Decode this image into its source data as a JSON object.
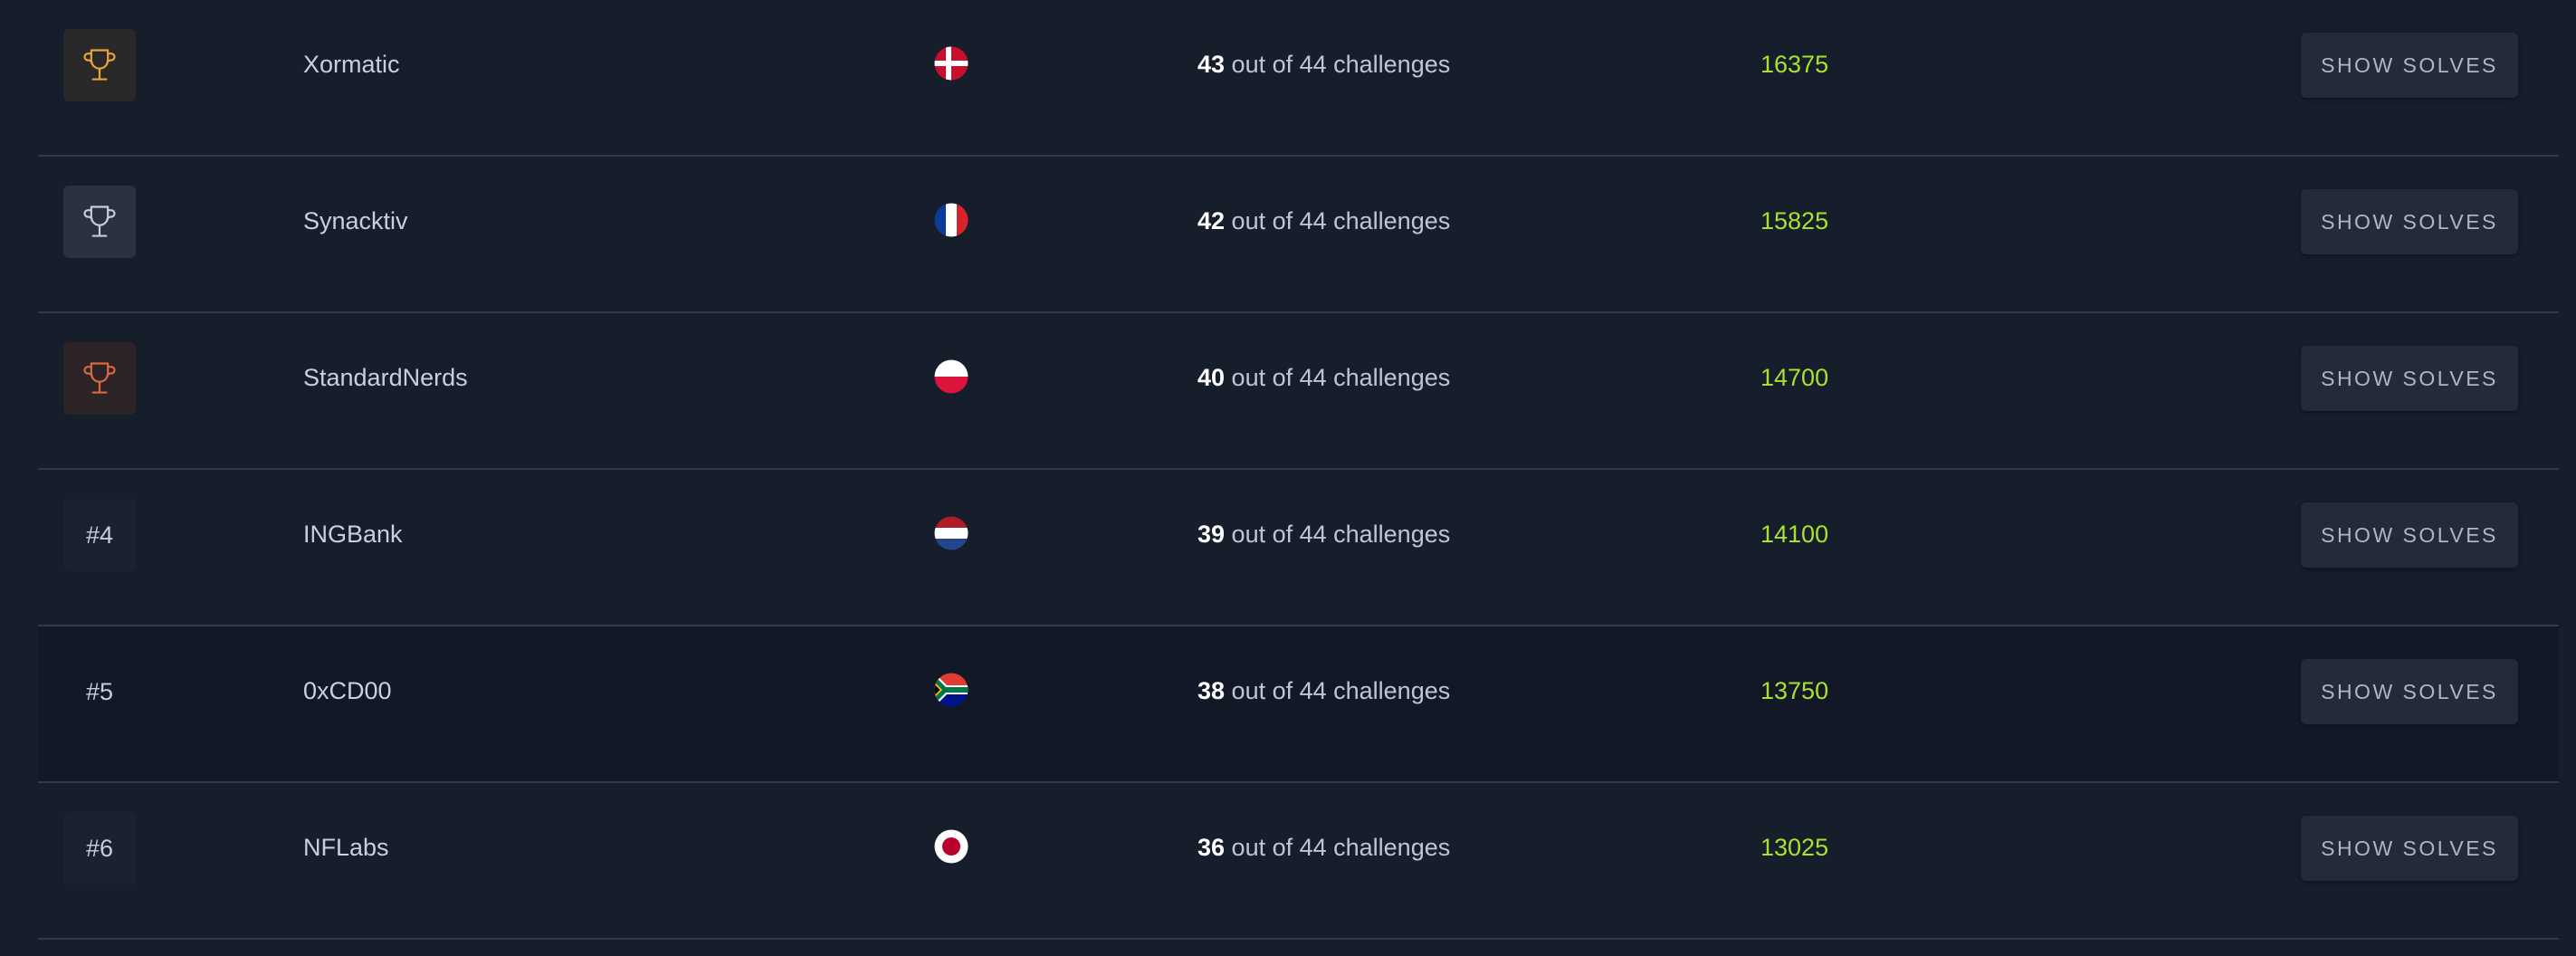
{
  "colors": {
    "background": "#161d2b",
    "points": "#a7e22e",
    "gold": "#e8a33a",
    "silver": "#c8ccd4",
    "bronze": "#d9693f"
  },
  "rows": [
    {
      "rank_label": "",
      "rank_icon": "trophy-gold-icon",
      "team": "Xormatic",
      "flag_icon": "flag-denmark-icon",
      "solved": "43",
      "solved_suffix": " out of 44 challenges",
      "points": "16375",
      "button_label": "SHOW SOLVES"
    },
    {
      "rank_label": "",
      "rank_icon": "trophy-silver-icon",
      "team": "Synacktiv",
      "flag_icon": "flag-france-icon",
      "solved": "42",
      "solved_suffix": " out of 44 challenges",
      "points": "15825",
      "button_label": "SHOW SOLVES"
    },
    {
      "rank_label": "",
      "rank_icon": "trophy-bronze-icon",
      "team": "StandardNerds",
      "flag_icon": "flag-poland-icon",
      "solved": "40",
      "solved_suffix": " out of 44 challenges",
      "points": "14700",
      "button_label": "SHOW SOLVES"
    },
    {
      "rank_label": "#4",
      "team": "INGBank",
      "flag_icon": "flag-netherlands-icon",
      "solved": "39",
      "solved_suffix": " out of 44 challenges",
      "points": "14100",
      "button_label": "SHOW SOLVES"
    },
    {
      "rank_label": "#5",
      "team": "0xCD00",
      "flag_icon": "flag-south-africa-icon",
      "solved": "38",
      "solved_suffix": " out of 44 challenges",
      "points": "13750",
      "button_label": "SHOW SOLVES"
    },
    {
      "rank_label": "#6",
      "team": "NFLabs",
      "flag_icon": "flag-japan-icon",
      "solved": "36",
      "solved_suffix": " out of 44 challenges",
      "points": "13025",
      "button_label": "SHOW SOLVES"
    }
  ]
}
